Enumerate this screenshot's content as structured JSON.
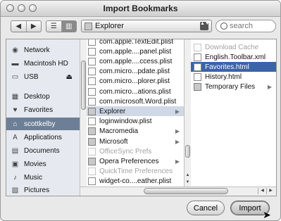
{
  "window": {
    "title": "Import Bookmarks"
  },
  "toolbar": {
    "back_glyph": "◀",
    "forward_glyph": "▶",
    "view_list_glyph": "☰",
    "view_columns_glyph": "▥",
    "location": "Explorer",
    "location_arrows": "▲▼",
    "search_placeholder": "search"
  },
  "sidebar": {
    "items": [
      {
        "label": "Network",
        "icon": "globe-icon",
        "glyph": "◉"
      },
      {
        "label": "Macintosh HD",
        "icon": "harddisk-icon",
        "glyph": "▬"
      },
      {
        "label": "USB",
        "icon": "usb-drive-icon",
        "glyph": "▭",
        "eject": "⏏"
      },
      {
        "label": "Desktop",
        "icon": "desktop-icon",
        "glyph": "▦"
      },
      {
        "label": "Favorites",
        "icon": "heart-icon",
        "glyph": "♥"
      },
      {
        "label": "scottkelby",
        "icon": "home-icon",
        "glyph": "⌂"
      },
      {
        "label": "Applications",
        "icon": "applications-icon",
        "glyph": "A"
      },
      {
        "label": "Documents",
        "icon": "documents-icon",
        "glyph": "▤"
      },
      {
        "label": "Movies",
        "icon": "movies-icon",
        "glyph": "▣"
      },
      {
        "label": "Music",
        "icon": "music-icon",
        "glyph": "♪"
      },
      {
        "label": "Pictures",
        "icon": "pictures-icon",
        "glyph": "▧"
      }
    ],
    "selected": "scottkelby"
  },
  "column1": {
    "items": [
      {
        "label": "com.apple.TextEdit.plist",
        "kind": "file"
      },
      {
        "label": "com.apple....panel.plist",
        "kind": "file"
      },
      {
        "label": "com.apple....ccess.plist",
        "kind": "file"
      },
      {
        "label": "com.micro...pdate.plist",
        "kind": "file"
      },
      {
        "label": "com.micro...plorer.plist",
        "kind": "file"
      },
      {
        "label": "com.micro...ations.plist",
        "kind": "file"
      },
      {
        "label": "com.microsoft.Word.plist",
        "kind": "file"
      },
      {
        "label": "Explorer",
        "kind": "folder",
        "selected": true
      },
      {
        "label": "loginwindow.plist",
        "kind": "file"
      },
      {
        "label": "Macromedia",
        "kind": "folder"
      },
      {
        "label": "Microsoft",
        "kind": "folder"
      },
      {
        "label": "OfficeSync Prefs",
        "kind": "file",
        "dim": true
      },
      {
        "label": "Opera Preferences",
        "kind": "folder"
      },
      {
        "label": "QuickTime Preferences",
        "kind": "file",
        "dim": true
      },
      {
        "label": "widget-co....eather.plist",
        "kind": "file"
      }
    ],
    "chevron": "▶"
  },
  "column2": {
    "items": [
      {
        "label": "Download Cache",
        "kind": "file",
        "dim": true
      },
      {
        "label": "English.Toolbar.xml",
        "kind": "file"
      },
      {
        "label": "Favorites.html",
        "kind": "file",
        "selected": true
      },
      {
        "label": "History.html",
        "kind": "file"
      },
      {
        "label": "Temporary Files",
        "kind": "folder"
      }
    ]
  },
  "buttons": {
    "cancel": "Cancel",
    "import": "Import"
  }
}
